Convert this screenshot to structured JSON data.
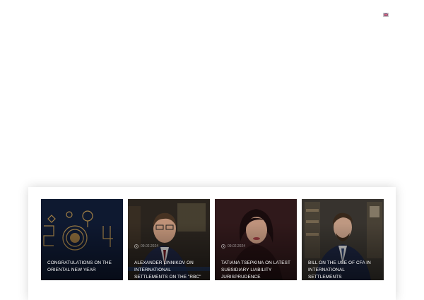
{
  "header": {
    "language_flag": "uk-flag-icon"
  },
  "news": {
    "cards": [
      {
        "date": "",
        "title": "CONGRATULATIONS ON THE ORIENTAL NEW YEAR",
        "image": "lunar-new-year-2024-image"
      },
      {
        "date": "09.02.2024",
        "title": "ALEXANDER LINNIKOV ON INTERNATIONAL SETTLEMENTS ON THE \"RBC\" CHANNEL",
        "image": "man-in-suit-image"
      },
      {
        "date": "09.02.2024",
        "title": "TATIANA TSEPKINA ON LATEST SUBSIDIARY LIABILITY JURISPRUDENCE",
        "image": "woman-portrait-image"
      },
      {
        "date": "",
        "title": "BILL ON THE USE OF CFA IN INTERNATIONAL SETTLEMENTS",
        "image": "man-in-office-image"
      }
    ]
  },
  "colors": {
    "panel_bg": "#ffffff",
    "card_text": "#ffffff"
  }
}
